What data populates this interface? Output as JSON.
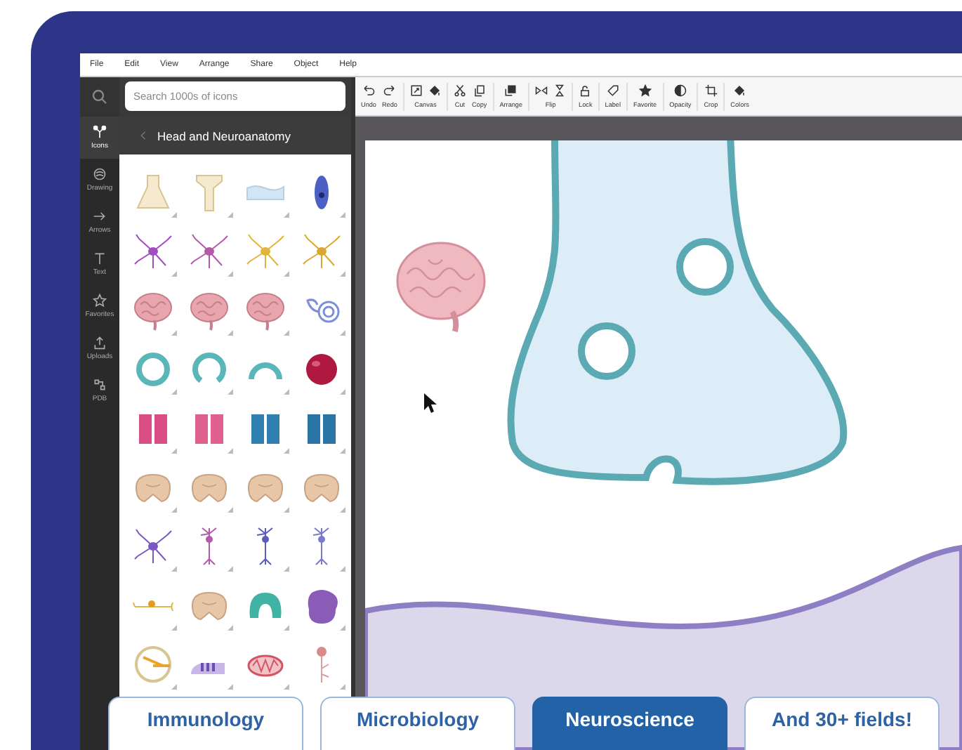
{
  "menu": [
    {
      "label": "File"
    },
    {
      "label": "Edit"
    },
    {
      "label": "View"
    },
    {
      "label": "Arrange"
    },
    {
      "label": "Share"
    },
    {
      "label": "Object"
    },
    {
      "label": "Help"
    }
  ],
  "search": {
    "placeholder": "Search 1000s of icons"
  },
  "rail": [
    {
      "kind": "icons",
      "label": "Icons",
      "selected": true
    },
    {
      "kind": "drawing",
      "label": "Drawing",
      "selected": false
    },
    {
      "kind": "arrows",
      "label": "Arrows",
      "selected": false
    },
    {
      "kind": "text",
      "label": "Text",
      "selected": false
    },
    {
      "kind": "favorites",
      "label": "Favorites",
      "selected": false
    },
    {
      "kind": "uploads",
      "label": "Uploads",
      "selected": false
    },
    {
      "kind": "pdb",
      "label": "PDB",
      "selected": false
    }
  ],
  "panel": {
    "title": "Head and Neuroanatomy"
  },
  "toolbar": [
    [
      {
        "label": "Undo",
        "icons": [
          {
            "kind": "undo"
          }
        ]
      },
      {
        "label": "Redo",
        "icons": [
          {
            "kind": "redo"
          }
        ]
      }
    ],
    [
      {
        "label": "Canvas",
        "icons": [
          {
            "kind": "resize"
          },
          {
            "kind": "bucket"
          }
        ]
      }
    ],
    [
      {
        "label": "Cut",
        "icons": [
          {
            "kind": "cut"
          }
        ]
      },
      {
        "label": "Copy",
        "icons": [
          {
            "kind": "copy"
          }
        ]
      }
    ],
    [
      {
        "label": "Arrange",
        "icons": [
          {
            "kind": "arrange"
          }
        ]
      }
    ],
    [
      {
        "label": "Flip",
        "icons": [
          {
            "kind": "fliph"
          },
          {
            "kind": "flipv"
          }
        ]
      }
    ],
    [
      {
        "label": "Lock",
        "icons": [
          {
            "kind": "lock"
          }
        ]
      }
    ],
    [
      {
        "label": "Label",
        "icons": [
          {
            "kind": "tag"
          }
        ]
      }
    ],
    [
      {
        "label": "Favorite",
        "icons": [
          {
            "kind": "star"
          }
        ]
      }
    ],
    [
      {
        "label": "Opacity",
        "icons": [
          {
            "kind": "contrast"
          }
        ]
      }
    ],
    [
      {
        "label": "Crop",
        "icons": [
          {
            "kind": "crop"
          }
        ]
      }
    ],
    [
      {
        "label": "Colors",
        "icons": [
          {
            "kind": "bucket"
          }
        ]
      }
    ]
  ],
  "fields": [
    {
      "label": "Immunology",
      "selected": false
    },
    {
      "label": "Microbiology",
      "selected": false
    },
    {
      "label": "Neuroscience",
      "selected": true
    },
    {
      "label": "And 30+ fields!",
      "selected": false
    }
  ]
}
